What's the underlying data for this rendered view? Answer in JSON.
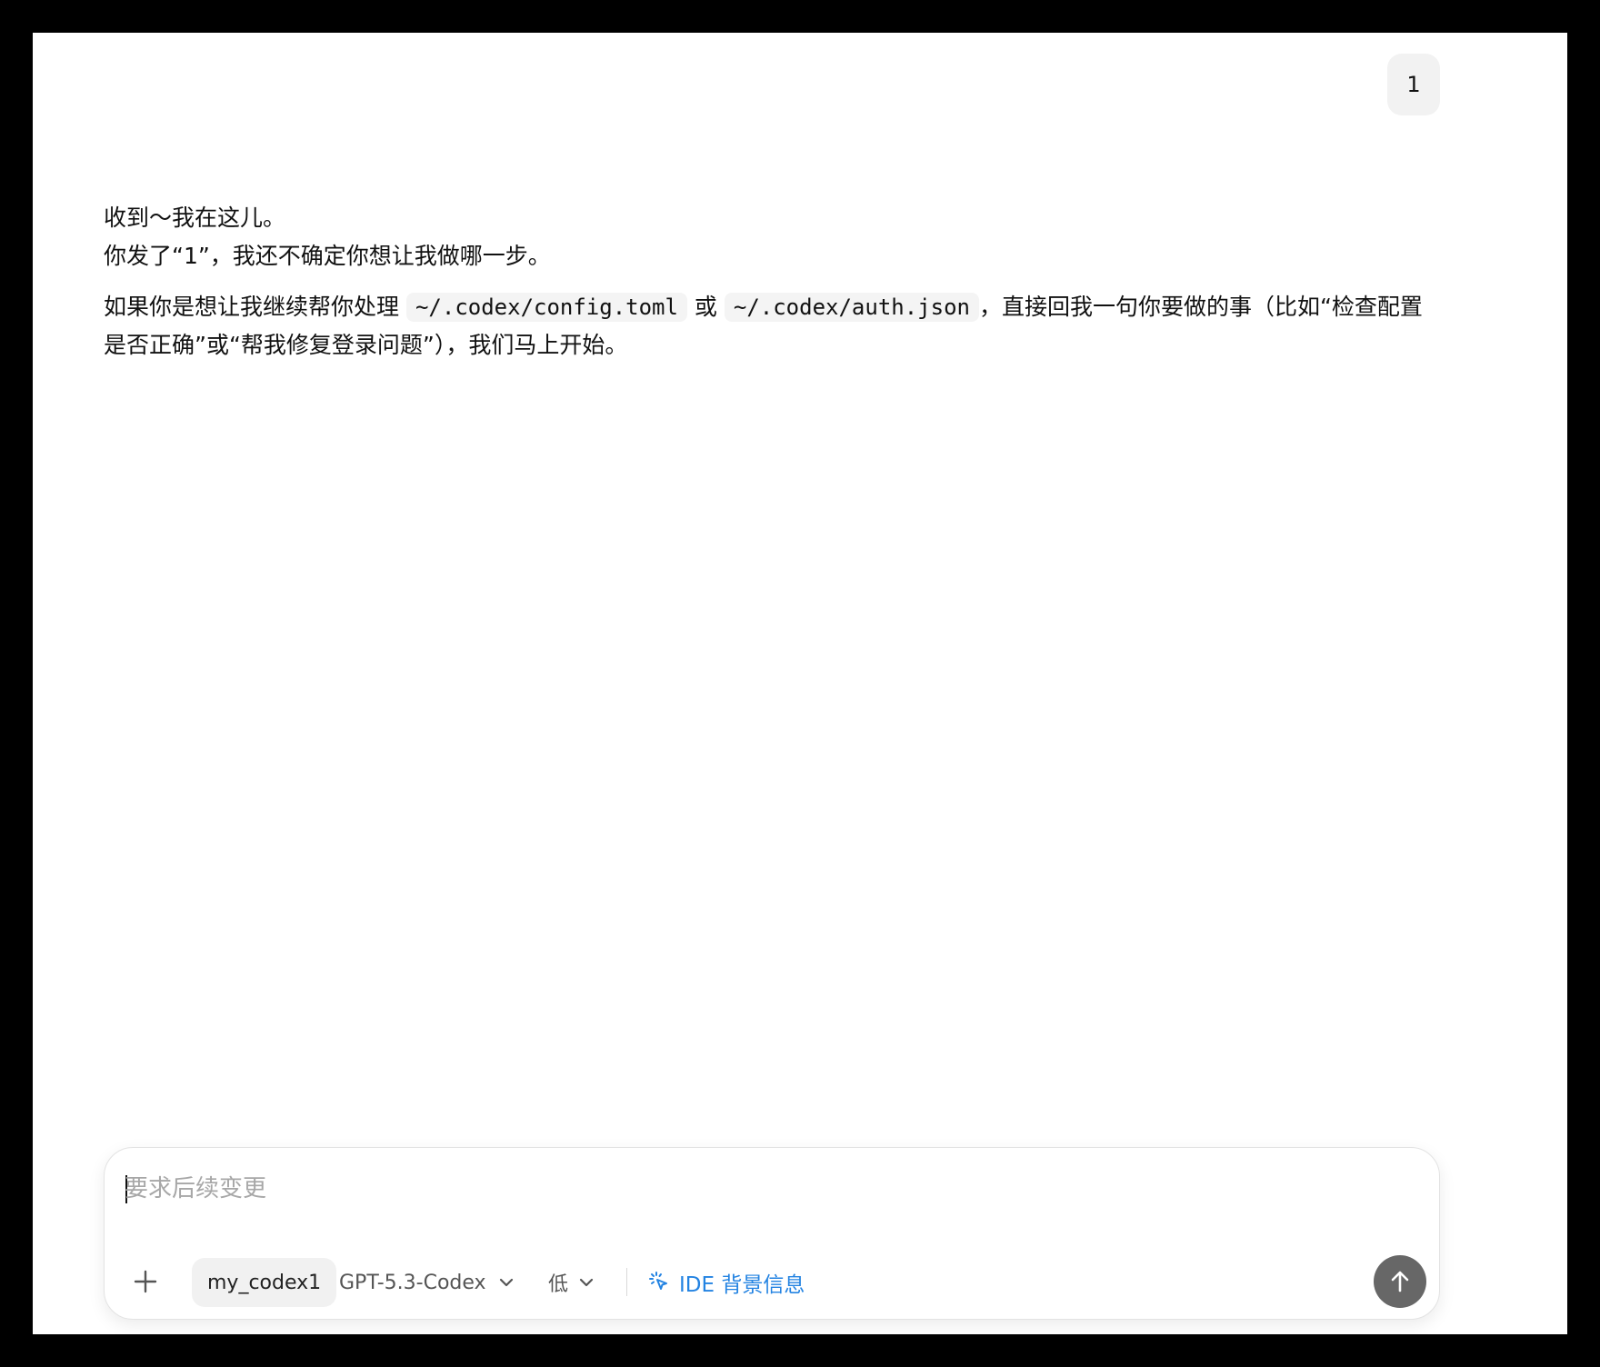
{
  "conversation": {
    "user_message": "1",
    "assistant": {
      "line1": "收到～我在这儿。",
      "line2": "你发了“1”，我还不确定你想让我做哪一步。",
      "paragraph2": {
        "text_before": "如果你是想让我继续帮你处理",
        "code1": "~/.codex/config.toml",
        "text_middle": "或",
        "code2": "~/.codex/auth.json",
        "text_after": "，直接回我一句你要做的事（比如“检查配置是否正确”或“帮我修复登录问题”），我们马上开始。"
      }
    }
  },
  "composer": {
    "placeholder": "要求后续变更",
    "value": "",
    "workspace": "my_codex1",
    "model": "GPT-5.3-Codex",
    "effort": "低",
    "ide_context": "IDE 背景信息",
    "icons": {
      "add": "plus-icon",
      "model_dropdown": "chevron-down-icon",
      "effort_dropdown": "chevron-down-icon",
      "ide": "cursor-click-icon",
      "send": "arrow-up-icon"
    }
  },
  "colors": {
    "background": "#000000",
    "panel": "#ffffff",
    "bubble": "#f2f2f2",
    "accent": "#2383e2",
    "send_button": "#676767"
  }
}
